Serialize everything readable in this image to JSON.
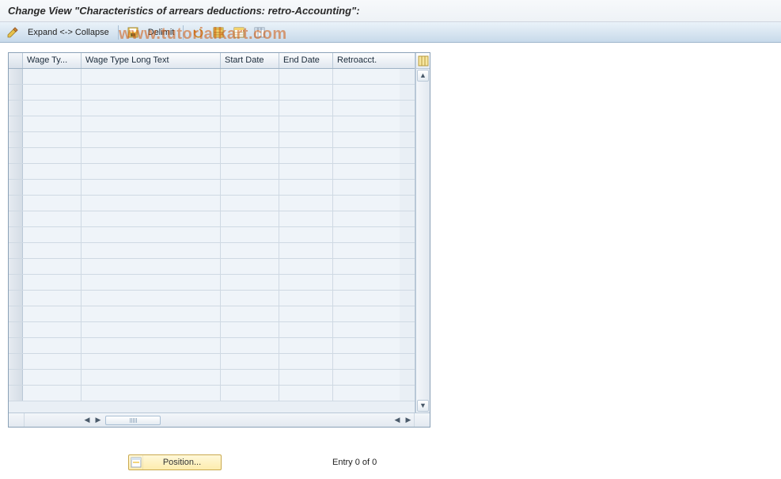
{
  "title": "Change View \"Characteristics of arrears deductions: retro-Accounting\":",
  "toolbar": {
    "expand_collapse": "Expand <-> Collapse",
    "delimit": "Delimit"
  },
  "watermark": "www.tutorialkart.com",
  "grid": {
    "columns": {
      "wage_type": "Wage Ty...",
      "wage_type_long": "Wage Type Long Text",
      "start_date": "Start Date",
      "end_date": "End Date",
      "retroacct": "Retroacct."
    },
    "rows": [
      {},
      {},
      {},
      {},
      {},
      {},
      {},
      {},
      {},
      {},
      {},
      {},
      {},
      {},
      {},
      {},
      {},
      {},
      {},
      {},
      {}
    ]
  },
  "footer": {
    "position_label": "Position...",
    "entry_text": "Entry 0 of 0"
  }
}
